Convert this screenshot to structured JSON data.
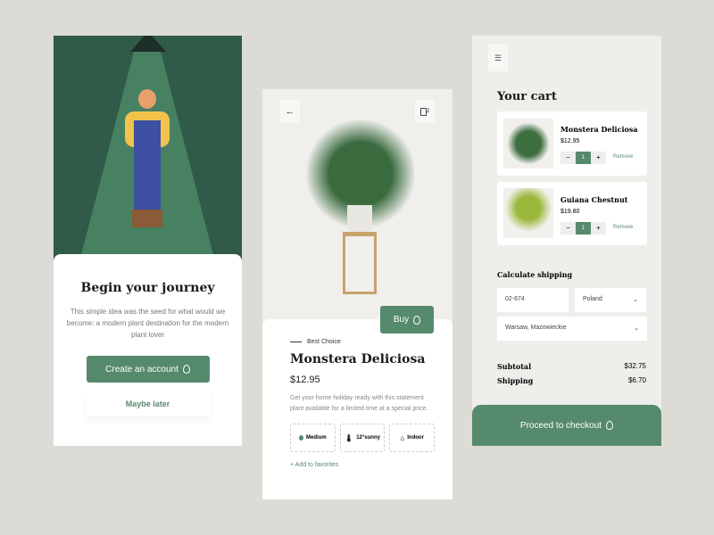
{
  "onboarding": {
    "title": "Begin your journey",
    "description": "This simple idea was the seed for what would we become: a modern plant destination for the modern plant lover",
    "create_label": "Create an account",
    "later_label": "Maybe later"
  },
  "product": {
    "tag": "Best Choice",
    "name": "Monstera Deliciosa",
    "price": "$12.95",
    "buy_label": "Buy",
    "description": "Get your home holiday ready with this statement plant available for a limited time at a special price.",
    "features": [
      {
        "icon": "water-drop-icon",
        "label": "Medium"
      },
      {
        "icon": "thermometer-icon",
        "label": "12°sunny"
      },
      {
        "icon": "house-icon",
        "label": "Indoor"
      }
    ],
    "favorites_label": "+ Add to favorites",
    "cart_count": "2"
  },
  "cart": {
    "title": "Your cart",
    "items": [
      {
        "name": "Monstera Deliciosa",
        "price": "$12.95",
        "qty": "1",
        "remove": "Remove"
      },
      {
        "name": "Guiana Chestnut",
        "price": "$19.80",
        "qty": "1",
        "remove": "Remove"
      }
    ],
    "shipping_title": "Calculate shipping",
    "postcode": "02-674",
    "country": "Poland",
    "city": "Warsaw, Mazowieckie",
    "subtotal_label": "Subtotal",
    "subtotal": "$32.75",
    "shipping_label": "Shipping",
    "shipping": "$6.70",
    "checkout_label": "Proceed to checkout"
  },
  "colors": {
    "accent": "#568a6d"
  }
}
